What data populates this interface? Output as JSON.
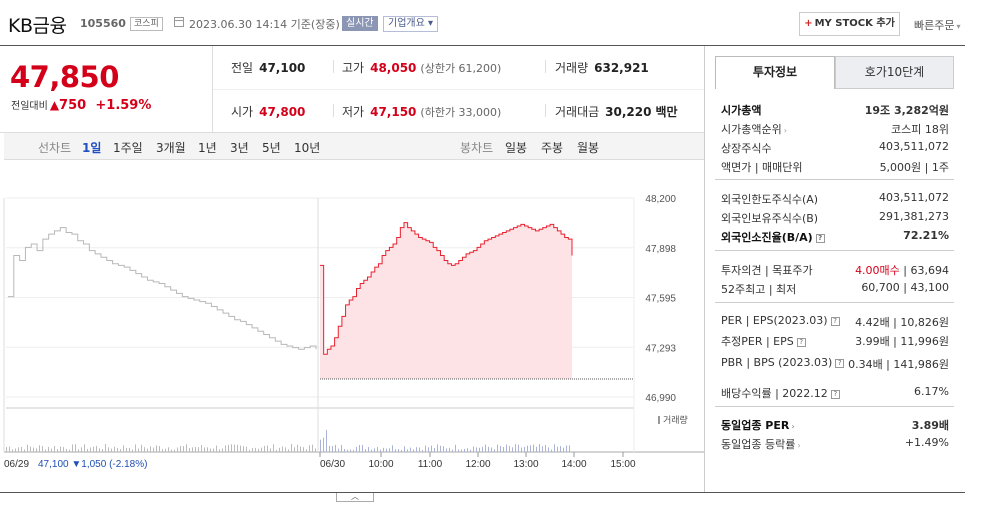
{
  "header": {
    "name": "KB금융",
    "code": "105560",
    "market": "코스피",
    "datetime": "2023.06.30 14:14 기준(장중)",
    "realtime": "실시간",
    "company_info": "기업개요",
    "mystock": "MY STOCK 추가",
    "quick_order": "빠른주문"
  },
  "price": {
    "current": "47,850",
    "change_label": "전일대비",
    "change": "750",
    "change_pct": "+1.59%"
  },
  "quote": {
    "prev_label": "전일",
    "prev": "47,100",
    "high_label": "고가",
    "high": "48,050",
    "upper": "(상한가 61,200)",
    "volume_label": "거래량",
    "volume": "632,921",
    "open_label": "시가",
    "open": "47,800",
    "low_label": "저가",
    "low": "47,150",
    "lower": "(하한가 33,000)",
    "amount_label": "거래대금",
    "amount": "30,220",
    "amount_unit": "백만"
  },
  "toolbar": {
    "line_label": "선차트",
    "periods": [
      "1일",
      "1주일",
      "3개월",
      "1년",
      "3년",
      "5년",
      "10년"
    ],
    "candle_label": "봉차트",
    "candles": [
      "일봉",
      "주봉",
      "월봉"
    ]
  },
  "chart_data": {
    "type": "line",
    "ytick_labels": [
      "48,200",
      "47,898",
      "47,595",
      "47,293",
      "46,990"
    ],
    "ylim": [
      46990,
      48200
    ],
    "volume_label": "거래량",
    "xtick_labels": [
      "06/29",
      "06/30",
      "10:00",
      "11:00",
      "12:00",
      "13:00",
      "14:00",
      "15:00"
    ],
    "prev_day_note": {
      "date": "06/29",
      "close": "47,100",
      "change": "▼1,050",
      "pct": "(-2.18%)"
    },
    "series": [
      {
        "values": [
          47600,
          47850,
          47820,
          47900,
          47920,
          47880,
          47950,
          47980,
          48000,
          48020,
          47990,
          47980,
          47940,
          47920,
          47880,
          47860,
          47840,
          47820,
          47800,
          47790,
          47780,
          47760,
          47740,
          47720,
          47700,
          47690,
          47680,
          47660,
          47640,
          47620,
          47600,
          47590,
          47580,
          47570,
          47560,
          47540,
          47520,
          47500,
          47480,
          47460,
          47450,
          47430,
          47410,
          47390,
          47370,
          47350,
          47330,
          47310,
          47300,
          47290,
          47280,
          47290,
          47300,
          47280
        ]
      },
      {
        "values": [
          47790,
          47250,
          47280,
          47300,
          47350,
          47420,
          47480,
          47550,
          47580,
          47600,
          47650,
          47680,
          47700,
          47720,
          47750,
          47780,
          47800,
          47850,
          47880,
          47900,
          47920,
          47960,
          48020,
          48050,
          48020,
          48000,
          47980,
          47960,
          47950,
          47940,
          47930,
          47900,
          47880,
          47850,
          47820,
          47800,
          47790,
          47800,
          47820,
          47840,
          47860,
          47870,
          47880,
          47900,
          47920,
          47940,
          47950,
          47960,
          47970,
          47980,
          47990,
          48000,
          48010,
          48020,
          48030,
          48040,
          48030,
          48020,
          48010,
          48000,
          48010,
          48020,
          48030,
          48040,
          48020,
          48000,
          47980,
          47960,
          47950,
          47850
        ]
      }
    ]
  },
  "invest": {
    "tab1": "투자정보",
    "tab2": "호가10단계",
    "rows": [
      {
        "k": "시가총액",
        "v": "19조 3,282억원"
      },
      {
        "k": "시가총액순위",
        "v": "코스피 18위"
      },
      {
        "k": "상장주식수",
        "v": "403,511,072"
      },
      {
        "k": "액면가 | 매매단위",
        "v": "5,000원 | 1주"
      },
      {
        "k": "외국인한도주식수(A)",
        "v": "403,511,072"
      },
      {
        "k": "외국인보유주식수(B)",
        "v": "291,381,273"
      },
      {
        "k": "외국인소진율(B/A)",
        "v": "72.21%"
      },
      {
        "k": "투자의견 | 목표주가",
        "v1": "4.00매수",
        "v2": "63,694"
      },
      {
        "k": "52주최고 | 최저",
        "v": "60,700 | 43,100"
      },
      {
        "k": "PER | EPS(2023.03)",
        "v": "4.42배 | 10,826원"
      },
      {
        "k": "추정PER | EPS",
        "v": "3.99배 | 11,996원"
      },
      {
        "k": "PBR | BPS (2023.03)",
        "v": "0.34배 | 141,986원"
      },
      {
        "k": "배당수익률 | 2022.12",
        "v": "6.17%"
      },
      {
        "k": "동일업종 PER",
        "v": "3.89배"
      },
      {
        "k": "동일업종 등락률",
        "v": "+1.49%"
      }
    ]
  }
}
